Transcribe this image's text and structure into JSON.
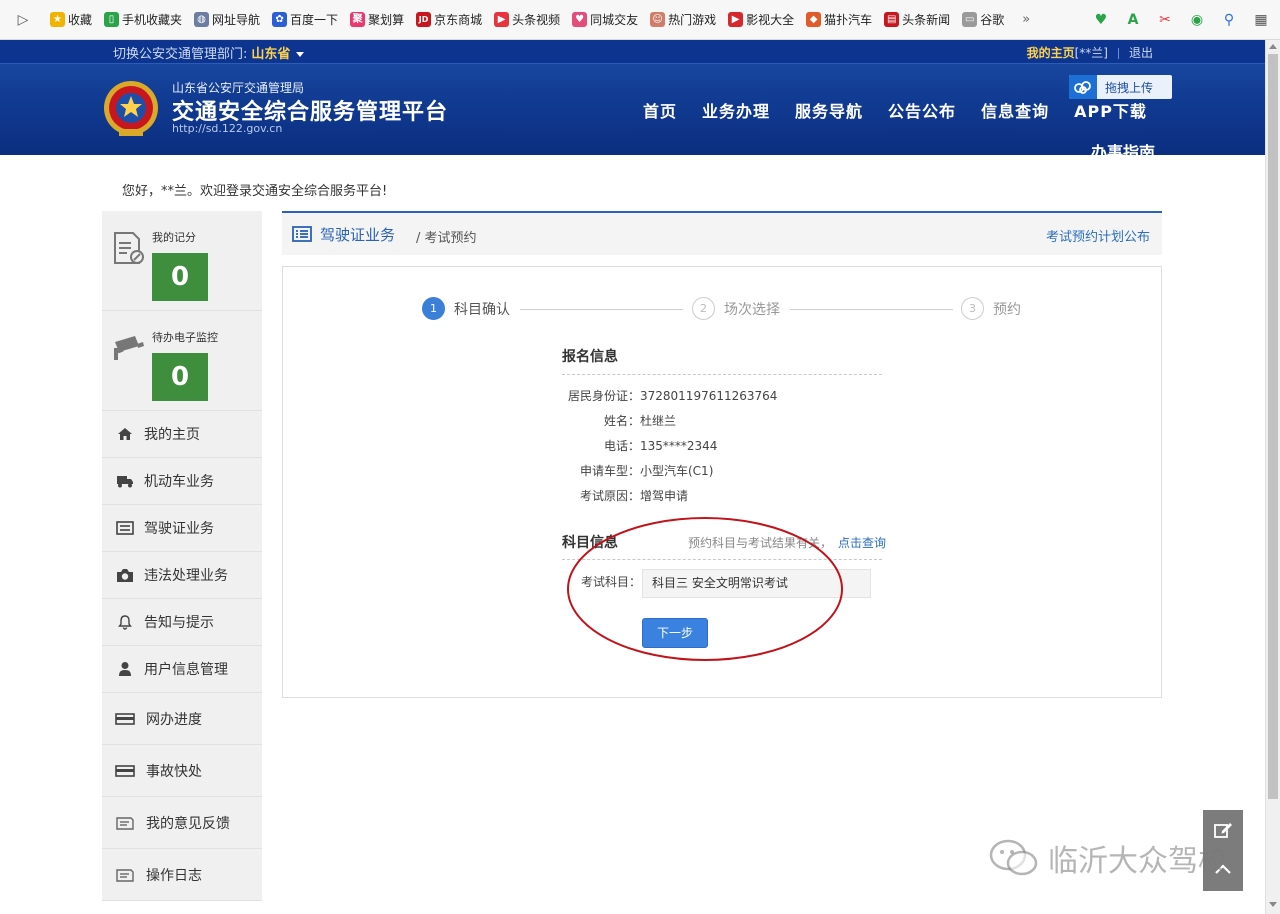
{
  "browser": {
    "bookmarks": [
      {
        "label": "收藏",
        "icon": "star-icon",
        "color": "#f0b400"
      },
      {
        "label": "手机收藏夹",
        "icon": "phone-icon",
        "color": "#2aa34a"
      },
      {
        "label": "网址导航",
        "icon": "globe-icon",
        "color": "#6c7ea0"
      },
      {
        "label": "百度一下",
        "icon": "paw-icon",
        "color": "#2b5fd6"
      },
      {
        "label": "聚划算",
        "icon": "juhuasuan-icon",
        "color": "#e8386d"
      },
      {
        "label": "京东商城",
        "icon": "jd-icon",
        "color": "#c8161e"
      },
      {
        "label": "头条视频",
        "icon": "play-icon",
        "color": "#e8323c"
      },
      {
        "label": "同城交友",
        "icon": "heart-icon",
        "color": "#e44d7a"
      },
      {
        "label": "热门游戏",
        "icon": "avatar-icon",
        "color": "#d07e6a"
      },
      {
        "label": "影视大全",
        "icon": "video-icon",
        "color": "#d8282f"
      },
      {
        "label": "猫扑汽车",
        "icon": "car-icon",
        "color": "#e05a2b"
      },
      {
        "label": "头条新闻",
        "icon": "news-icon",
        "color": "#c8161e"
      },
      {
        "label": "谷歌",
        "icon": "page-icon",
        "color": "#9a9a9a"
      }
    ],
    "more_label": "»"
  },
  "header": {
    "dept_label": "切换公安交通管理部门:",
    "dept_value": "山东省",
    "my_home": "我的主页",
    "user": "[**兰]",
    "logout": "退出",
    "org_name": "山东省公安厅交通管理局",
    "platform_title": "交通安全综合服务管理平台",
    "platform_url": "http://sd.122.gov.cn",
    "upload_label": "拖拽上传",
    "nav": [
      "首页",
      "业务办理",
      "服务导航",
      "公告公布",
      "信息查询",
      "APP下载"
    ],
    "nav_guide": "办事指南"
  },
  "welcome": "您好，**兰。欢迎登录交通安全综合服务平台!",
  "sidebar": {
    "score_label": "我的记分",
    "score_value": "0",
    "monitor_label": "待办电子监控",
    "monitor_value": "0",
    "items": [
      {
        "label": "我的主页",
        "icon": "home-icon"
      },
      {
        "label": "机动车业务",
        "icon": "truck-icon"
      },
      {
        "label": "驾驶证业务",
        "icon": "list-icon"
      },
      {
        "label": "违法处理业务",
        "icon": "camera-icon"
      },
      {
        "label": "告知与提示",
        "icon": "bell-icon"
      },
      {
        "label": "用户信息管理",
        "icon": "user-icon"
      },
      {
        "label": "网办进度",
        "icon": "card-icon"
      },
      {
        "label": "事故快处",
        "icon": "card-icon"
      },
      {
        "label": "我的意见反馈",
        "icon": "feedback-icon"
      },
      {
        "label": "操作日志",
        "icon": "log-icon"
      }
    ]
  },
  "breadcrumb": {
    "main": "驾驶证业务",
    "sub": "/ 考试预约",
    "right_link": "考试预约计划公布"
  },
  "steps": [
    {
      "num": "1",
      "label": "科目确认",
      "active": true
    },
    {
      "num": "2",
      "label": "场次选择",
      "active": false
    },
    {
      "num": "3",
      "label": "预约",
      "active": false
    }
  ],
  "registration": {
    "title": "报名信息",
    "rows": [
      {
        "label": "居民身份证：",
        "value": "372801197611263764"
      },
      {
        "label": "姓名：",
        "value": "杜继兰"
      },
      {
        "label": "电话：",
        "value": "135****2344"
      },
      {
        "label": "申请车型：",
        "value": "小型汽车(C1)"
      },
      {
        "label": "考试原因：",
        "value": "增驾申请"
      }
    ]
  },
  "subject": {
    "title": "科目信息",
    "hint": "预约科目与考试结果有关，",
    "hint_link": "点击查询",
    "label": "考试科目：",
    "value": "科目三 安全文明常识考试",
    "next_button": "下一步"
  },
  "watermark": "临沂大众驾校",
  "colors": {
    "header_blue": "#123d95",
    "accent_blue": "#2b62b5",
    "score_green": "#3e8e3e",
    "highlight_red": "#c0141c",
    "dept_yellow": "#ffd24c"
  }
}
